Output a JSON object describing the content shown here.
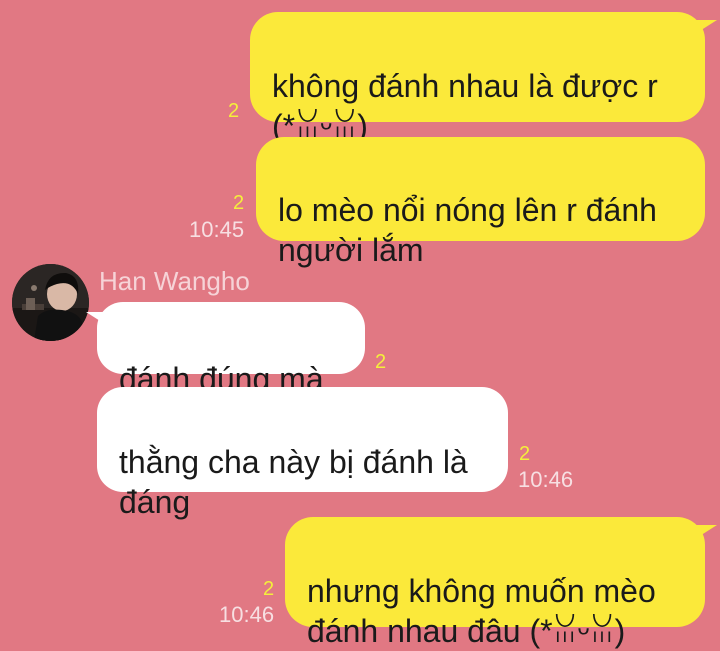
{
  "chat": {
    "messages": [
      {
        "direction": "out",
        "text": "không đánh nhau là được r\n(*ꈍᵕꈍ)",
        "unread": "2",
        "time": ""
      },
      {
        "direction": "out",
        "text": "lo mèo nổi nóng lên r đánh\nngười lắm",
        "unread": "2",
        "time": "10:45"
      },
      {
        "direction": "in",
        "sender": "Han Wangho",
        "text": "đánh đúng mà",
        "unread": "2",
        "time": ""
      },
      {
        "direction": "in",
        "text": "thằng cha này bị đánh là\nđáng",
        "unread": "2",
        "time": "10:46"
      },
      {
        "direction": "out",
        "text": "nhưng không muốn mèo\nđánh nhau đâu (*ꈍᵕꈍ)",
        "unread": "2",
        "time": "10:46"
      }
    ]
  },
  "colors": {
    "background": "#e17883",
    "outgoing_bubble": "#fbe93a",
    "incoming_bubble": "#ffffff",
    "unread_count": "#f4ef3b",
    "timestamp": "#f7dfe2",
    "sender_name": "#f6d3d7"
  },
  "icons": {
    "avatar": "user-avatar-photo"
  }
}
